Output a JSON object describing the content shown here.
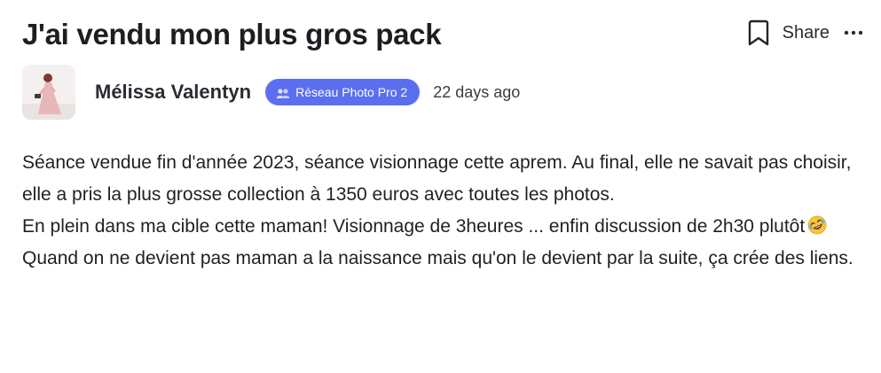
{
  "post": {
    "title": "J'ai vendu mon plus gros pack",
    "share_label": "Share",
    "author": {
      "name": "Mélissa Valentyn",
      "badge": "Réseau Photo Pro 2",
      "time": "22 days ago"
    },
    "paragraphs": [
      "Séance vendue fin d'année 2023, séance visionnage cette aprem. Au final, elle ne savait pas choisir, elle a pris la plus grosse collection à 1350 euros avec toutes les photos.",
      "En plein dans ma cible cette maman! Visionnage de 3heures ... enfin discussion de 2h30 plutôt",
      "Quand on ne devient pas maman a la naissance mais qu'on le devient par la suite, ça crée des liens."
    ],
    "emoji": "rolling-on-the-floor-laughing-emoji"
  },
  "colors": {
    "badge": "#5a6ff0",
    "text": "#1f2024",
    "background": "#ffffff"
  }
}
